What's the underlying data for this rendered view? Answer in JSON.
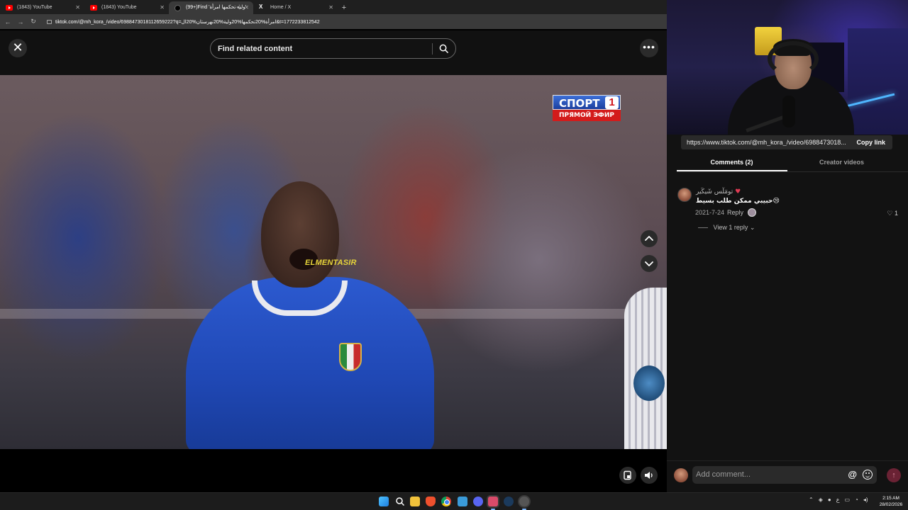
{
  "browser": {
    "tabs": [
      {
        "title": "(1843) YouTube",
        "icon": "youtube-icon",
        "active": false
      },
      {
        "title": "(1843) YouTube",
        "icon": "youtube-icon",
        "active": false
      },
      {
        "title": "(99+)Find 'وليه تحكمها امرأة'",
        "icon": "tiktok-icon",
        "active": true
      },
      {
        "title": "Home / X",
        "icon": "x-icon",
        "active": false
      }
    ],
    "new_tab": "+",
    "url": "tiktok.com/@mh_kora_/video/6988473018112659222?q=امرأة%20تحكمها%20ولية%20نهرستان%20ال&t=1772233812542"
  },
  "tiktok": {
    "search_placeholder": "Find related content",
    "close_glyph": "✕",
    "more_glyph": "•••",
    "video": {
      "watermark": "ELMENTASIR",
      "broadcast_channel": "СПОРТ",
      "broadcast_number": "1",
      "broadcast_live": "ПРЯМОЙ ЭФИР"
    }
  },
  "panel": {
    "link": "https://www.tiktok.com/@mh_kora_/video/6988473018...",
    "copy_link": "Copy link",
    "tabs": {
      "comments": "Comments (2)",
      "creator_videos": "Creator videos"
    },
    "comment": {
      "username": "ﺗﻮﻣٓﻠٓﺲ ﺷٓﻴﻜٓﻴﺮ",
      "username_emoji": "♥",
      "text": "حبيبي ممكن طلب بسيط😢",
      "date": "2021-7-24",
      "reply": "Reply",
      "likes": "1",
      "view_replies": "View 1 reply"
    },
    "composer": {
      "placeholder": "Add comment...",
      "at": "@",
      "send": "↑"
    }
  },
  "taskbar": {
    "tray_lang": "ع",
    "time": "2:15 AM",
    "date": "28/02/2026"
  },
  "colors": {
    "tiktok_bg": "#000000",
    "panel_bg": "#121212",
    "accent_send": "#6a2234",
    "broadcast_blue": "#1c3f9e",
    "broadcast_red": "#d31b1b",
    "watermark_yellow": "#e6d43a"
  }
}
